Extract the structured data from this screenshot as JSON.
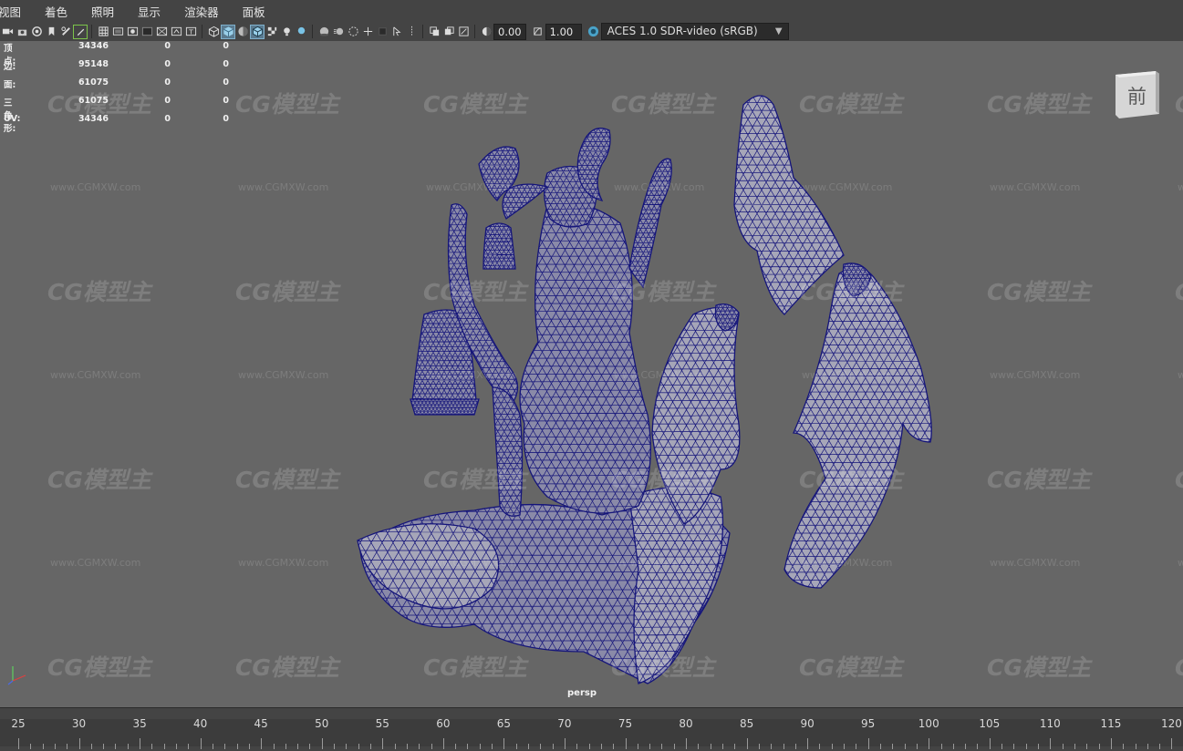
{
  "menubar": {
    "items": [
      "视图",
      "着色",
      "照明",
      "显示",
      "渲染器",
      "面板"
    ]
  },
  "toolbar": {
    "exposure_value": "0.00",
    "gamma_value": "1.00",
    "color_transform": "ACES 1.0 SDR-video (sRGB)",
    "icons": [
      "camera-icon",
      "camera-lock-icon",
      "bookmark-icon",
      "image-plane-icon",
      "pencil-icon",
      "grid-icon",
      "film-gate-icon",
      "resolution-gate-icon",
      "gate-mask-icon",
      "field-chart-icon",
      "safe-action-icon",
      "safe-title-icon",
      "wireframe-icon",
      "smooth-shade-icon",
      "default-material-icon",
      "wireframe-on-shaded-icon",
      "textured-icon",
      "lights-icon",
      "shadows-icon",
      "ambient-occlusion-icon",
      "motion-blur-icon",
      "antialias-icon",
      "isolate-select-icon",
      "xray-icon",
      "xray-joints-icon",
      "backface-icon",
      "exposure-icon",
      "gamma-icon",
      "color-management-icon"
    ],
    "colors": {
      "active": "#5a7a8f",
      "highlight": "#7cc44a"
    }
  },
  "hud": {
    "rows": [
      {
        "label": "顶点:",
        "values": [
          "34346",
          "0",
          "0"
        ]
      },
      {
        "label": "边:",
        "values": [
          "95148",
          "0",
          "0"
        ]
      },
      {
        "label": "面:",
        "values": [
          "61075",
          "0",
          "0"
        ]
      },
      {
        "label": "三角形:",
        "values": [
          "61075",
          "0",
          "0"
        ]
      },
      {
        "label": "UV:",
        "values": [
          "34346",
          "0",
          "0"
        ]
      }
    ]
  },
  "viewport": {
    "camera": "persp",
    "view_cube_face": "前",
    "watermark_logo": "CG模型主",
    "watermark_url": "www.CGMXW.com",
    "background": "#666666",
    "wire_color": "#15157a"
  },
  "timeline": {
    "ticks": [
      "25",
      "30",
      "35",
      "40",
      "45",
      "50",
      "55",
      "60",
      "65",
      "70",
      "75",
      "80",
      "85",
      "90",
      "95",
      "100",
      "105",
      "110",
      "115",
      "120"
    ]
  }
}
